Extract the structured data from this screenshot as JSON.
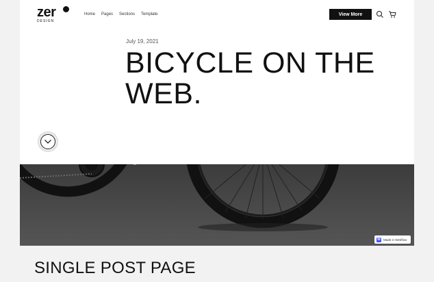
{
  "header": {
    "logo_text": "zer",
    "logo_sub": "DESIGN",
    "nav": [
      {
        "label": "Home"
      },
      {
        "label": "Pages"
      },
      {
        "label": "Sections"
      },
      {
        "label": "Template"
      }
    ],
    "cta_label": "View More",
    "icons": [
      "search-icon",
      "cart-icon"
    ]
  },
  "hero": {
    "date": "July 19, 2021",
    "headline": "BICYCLE ON THE WEB.",
    "scroll_icon": "chevron-down-icon"
  },
  "badge": {
    "mark": "W",
    "label": "Made in Webflow"
  },
  "caption": "SINGLE POST PAGE",
  "colors": {
    "cta_bg": "#111111",
    "page_bg": "#ffffff",
    "outer_bg": "#f2f2f2",
    "photo_bg": "#333333",
    "webflow_blue": "#4353ff"
  }
}
